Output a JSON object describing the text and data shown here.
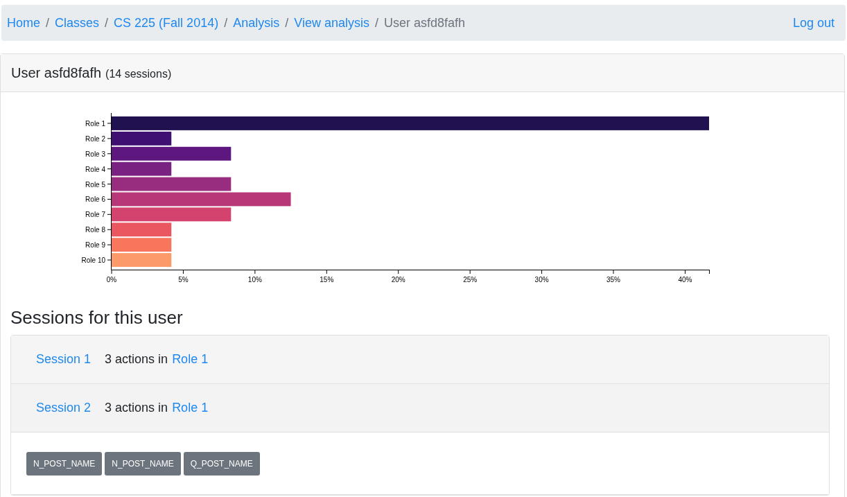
{
  "breadcrumb": [
    {
      "label": "Home",
      "current": false
    },
    {
      "separator": "/",
      "label": "Classes",
      "current": false
    },
    {
      "separator": "/",
      "label": "CS 225 (Fall 2014)",
      "current": false
    },
    {
      "separator": "/",
      "label": "Analysis",
      "current": false
    },
    {
      "separator": "/",
      "label": "View analysis",
      "current": false
    },
    {
      "separator": "/",
      "label": "User asfd8fafh",
      "current": true
    }
  ],
  "logout": "Log out",
  "card": {
    "title": "User asfd8fafh",
    "subtitle": "(14 sessions)"
  },
  "chart_data": {
    "type": "bar",
    "orientation": "horizontal",
    "categories": [
      "Role 1",
      "Role 2",
      "Role 3",
      "Role 4",
      "Role 5",
      "Role 6",
      "Role 7",
      "Role 8",
      "Role 9",
      "Role 10"
    ],
    "series": [
      {
        "values": [
          41.67,
          4.17,
          8.33,
          4.17,
          8.33,
          12.5,
          8.33,
          4.17,
          4.17,
          4.17
        ]
      }
    ],
    "colors": [
      "#221150",
      "#3f0f72",
      "#5d177f",
      "#7a2281",
      "#982d80",
      "#b73779",
      "#d3436e",
      "#eb5760",
      "#f8765c",
      "#fd9a6a"
    ],
    "xlim": [
      0,
      41.67
    ],
    "xticks": [
      {
        "value": 0,
        "label": "0%"
      },
      {
        "value": 5,
        "label": "5%"
      },
      {
        "value": 10,
        "label": "10%"
      },
      {
        "value": 15,
        "label": "15%"
      },
      {
        "value": 20,
        "label": "20%"
      },
      {
        "value": 25,
        "label": "25%"
      },
      {
        "value": 30,
        "label": "30%"
      },
      {
        "value": 35,
        "label": "35%"
      },
      {
        "value": 40,
        "label": "40%"
      }
    ]
  },
  "sessions_heading": "Sessions for this user",
  "sessions": [
    {
      "label": "Session 1",
      "summary": "3 actions in",
      "role": "Role 1",
      "expanded": false
    },
    {
      "label": "Session 2",
      "summary": "3 actions in",
      "role": "Role 1",
      "expanded": true,
      "actions": [
        "N_POST_NAME",
        "N_POST_NAME",
        "Q_POST_NAME"
      ]
    }
  ]
}
